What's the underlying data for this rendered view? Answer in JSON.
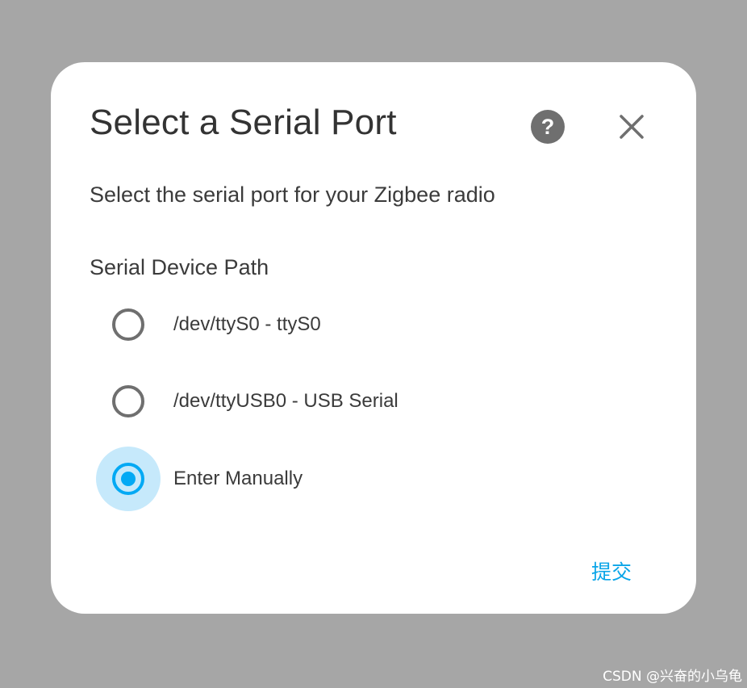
{
  "dialog": {
    "title": "Select a Serial Port",
    "subtitle": "Select the serial port for your Zigbee radio",
    "field_label": "Serial Device Path",
    "help_icon": "help-circle-icon",
    "close_icon": "close-icon",
    "options": [
      {
        "label": "/dev/ttyS0 - ttyS0",
        "selected": false
      },
      {
        "label": "/dev/ttyUSB0 - USB Serial",
        "selected": false
      },
      {
        "label": "Enter Manually",
        "selected": true
      }
    ],
    "submit_label": "提交"
  },
  "colors": {
    "accent": "#03a9f4",
    "selected_halo": "#c6e9fb",
    "icon_gray": "#6f6f6f",
    "overlay": "#a6a6a6"
  },
  "watermark": "CSDN @兴奋的小乌龟"
}
